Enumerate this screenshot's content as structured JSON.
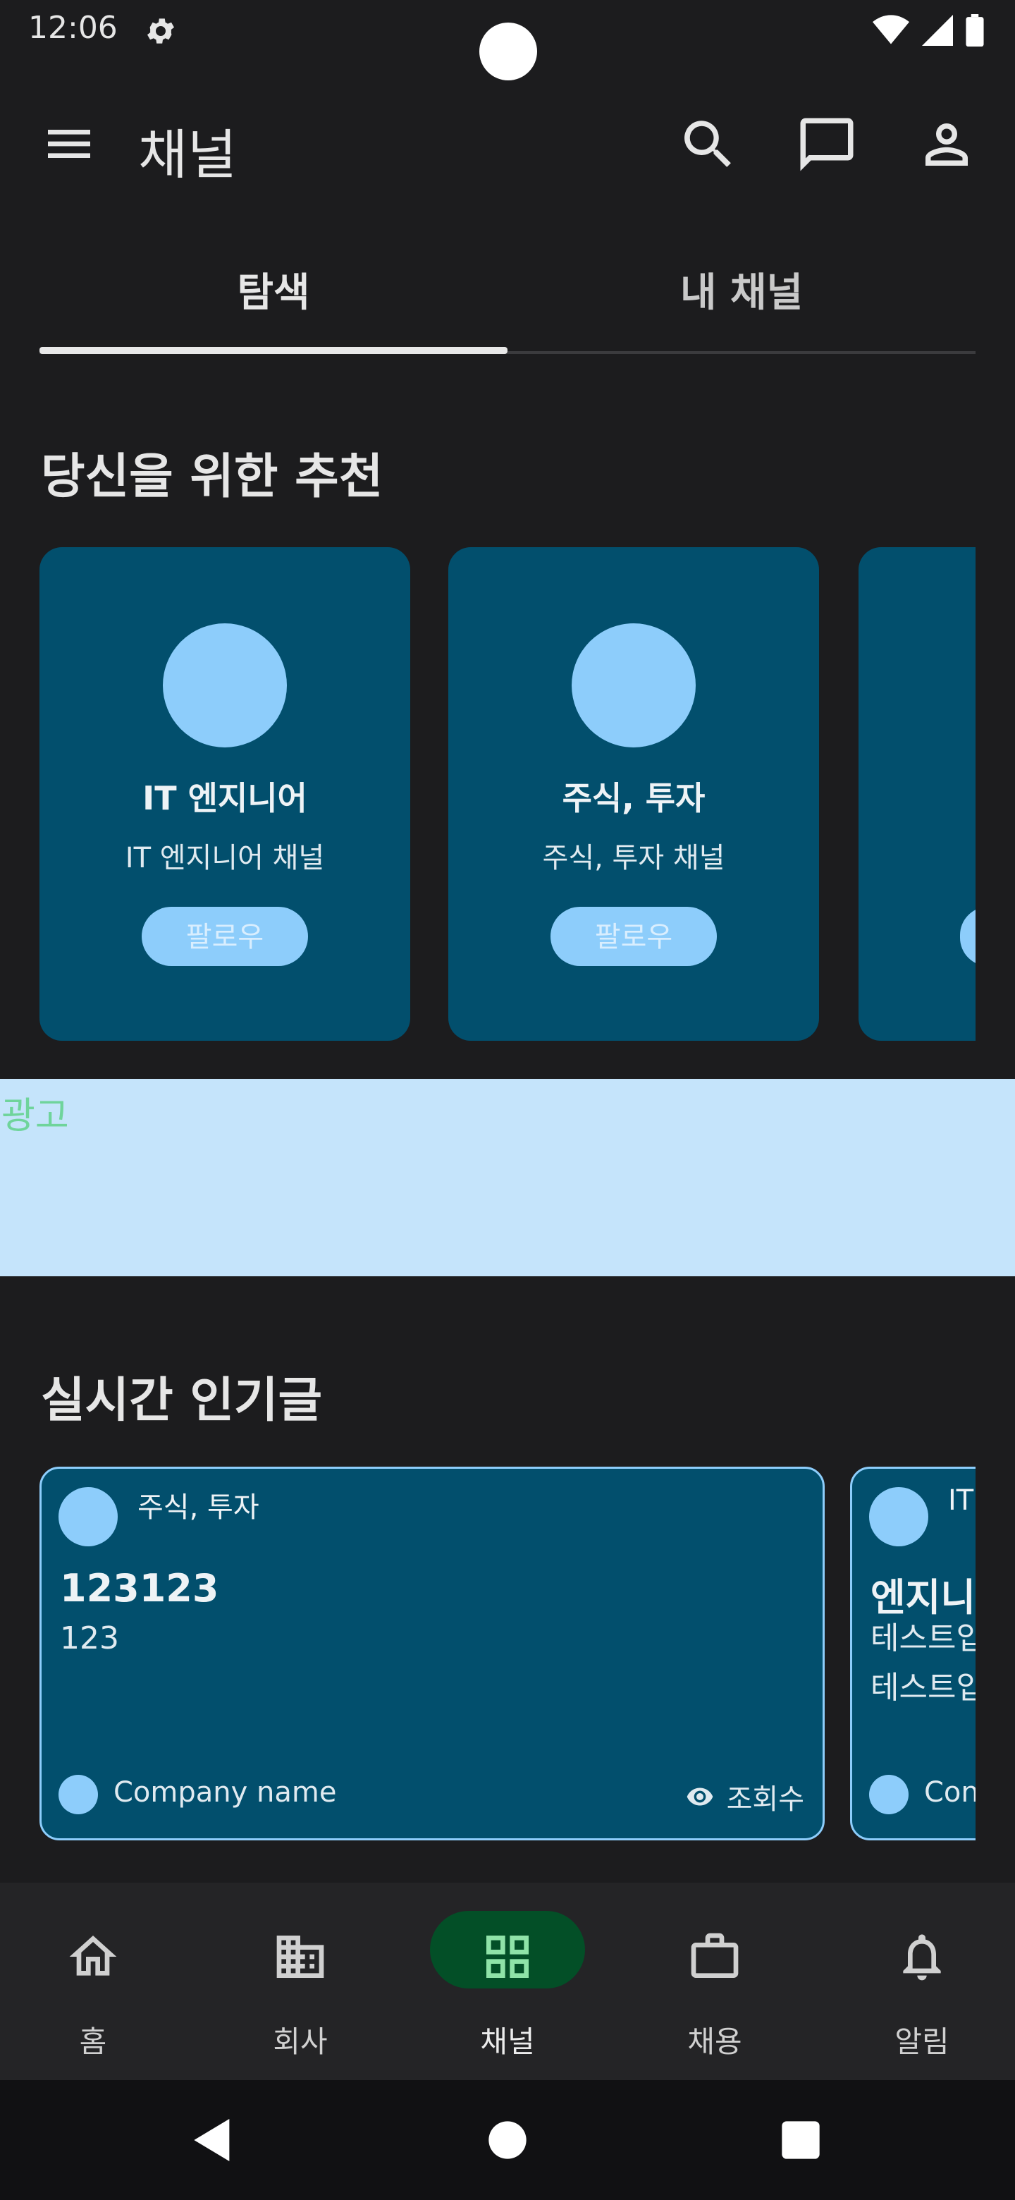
{
  "status_bar": {
    "time": "12:06"
  },
  "app_bar": {
    "title": "채널",
    "icons": [
      "menu-icon",
      "search-icon",
      "chat-icon",
      "profile-icon"
    ]
  },
  "tabs": [
    {
      "label": "탐색",
      "selected": true
    },
    {
      "label": "내 채널",
      "selected": false
    }
  ],
  "recommendations": {
    "title": "당신을 위한 추천",
    "cards": [
      {
        "name": "IT 엔지니어",
        "description": "IT 엔지니어 채널",
        "follow_label": "팔로우"
      },
      {
        "name": "주식, 투자",
        "description": "주식, 투자 채널",
        "follow_label": "팔로우"
      },
      {
        "name": "",
        "description": "",
        "follow_label": ""
      }
    ]
  },
  "ad": {
    "label": "광고"
  },
  "popular": {
    "title": "실시간 인기글",
    "posts": [
      {
        "channel": "주식, 투자",
        "title": "123123",
        "body_lines": [
          "123"
        ],
        "company": "Company name",
        "views_label": "조회수"
      },
      {
        "channel": "IT",
        "title": "엔지니",
        "body_lines": [
          "테스트입",
          "테스트입"
        ],
        "company": "Con",
        "views_label": ""
      }
    ]
  },
  "bottom_nav": {
    "items": [
      {
        "label": "홈",
        "icon": "home-icon",
        "active": false
      },
      {
        "label": "회사",
        "icon": "building-icon",
        "active": false
      },
      {
        "label": "채널",
        "icon": "grid-icon",
        "active": true
      },
      {
        "label": "채용",
        "icon": "briefcase-icon",
        "active": false
      },
      {
        "label": "알림",
        "icon": "bell-icon",
        "active": false
      }
    ]
  },
  "colors": {
    "background": "#1c1c1e",
    "card": "#024f6d",
    "accent_blue": "#8dcdfb",
    "ad_background": "#c5e4fb",
    "ad_text": "#6fd49b",
    "nav_active_pill": "#034f27",
    "nav_active_icon": "#8fe3a8"
  }
}
